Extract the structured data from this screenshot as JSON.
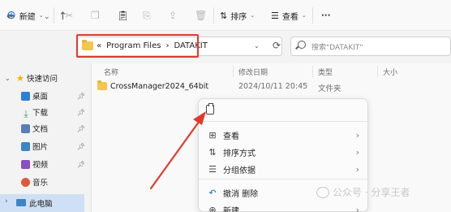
{
  "toolbar": {
    "new_label": "新建",
    "sort_label": "排序",
    "view_label": "查看",
    "more_label": "···"
  },
  "address": {
    "prefix": "«",
    "crumbs": [
      "Program Files",
      "›",
      "DATAKIT"
    ]
  },
  "search": {
    "placeholder": "搜索\"DATAKIT\""
  },
  "sidebar": {
    "quick_access": "快速访问",
    "items": [
      {
        "label": "桌面",
        "icon": "desktop-icon",
        "color": "#2f7fd6"
      },
      {
        "label": "下载",
        "icon": "download-icon",
        "color": "#3a9a5c"
      },
      {
        "label": "文档",
        "icon": "document-icon",
        "color": "#5b7fb5"
      },
      {
        "label": "图片",
        "icon": "pictures-icon",
        "color": "#3d86c6"
      },
      {
        "label": "视频",
        "icon": "video-icon",
        "color": "#8a4fc2"
      },
      {
        "label": "音乐",
        "icon": "music-icon",
        "color": "#e05a3a"
      }
    ],
    "this_pc": "此电脑"
  },
  "columns": {
    "name": "名称",
    "date": "修改日期",
    "type": "类型",
    "size": "大小"
  },
  "files": [
    {
      "name": "CrossManager2024_64bit",
      "date": "2024/10/11 20:45",
      "type": "文件夹",
      "size": ""
    }
  ],
  "context_menu": {
    "items": [
      {
        "label": "查看",
        "icon": "grid-icon",
        "has_submenu": true
      },
      {
        "label": "排序方式",
        "icon": "sort-icon",
        "has_submenu": true
      },
      {
        "label": "分组依据",
        "icon": "group-icon",
        "has_submenu": true
      },
      {
        "label": "撤消 删除",
        "icon": "undo-icon",
        "has_submenu": false
      },
      {
        "label": "新建",
        "icon": "new-icon",
        "has_submenu": true
      }
    ]
  },
  "watermark": "公众号 · 分享王者",
  "colors": {
    "highlight_red": "#e03a2e",
    "folder_yellow": "#f4c54f",
    "selection_blue": "#cfe0f4"
  }
}
